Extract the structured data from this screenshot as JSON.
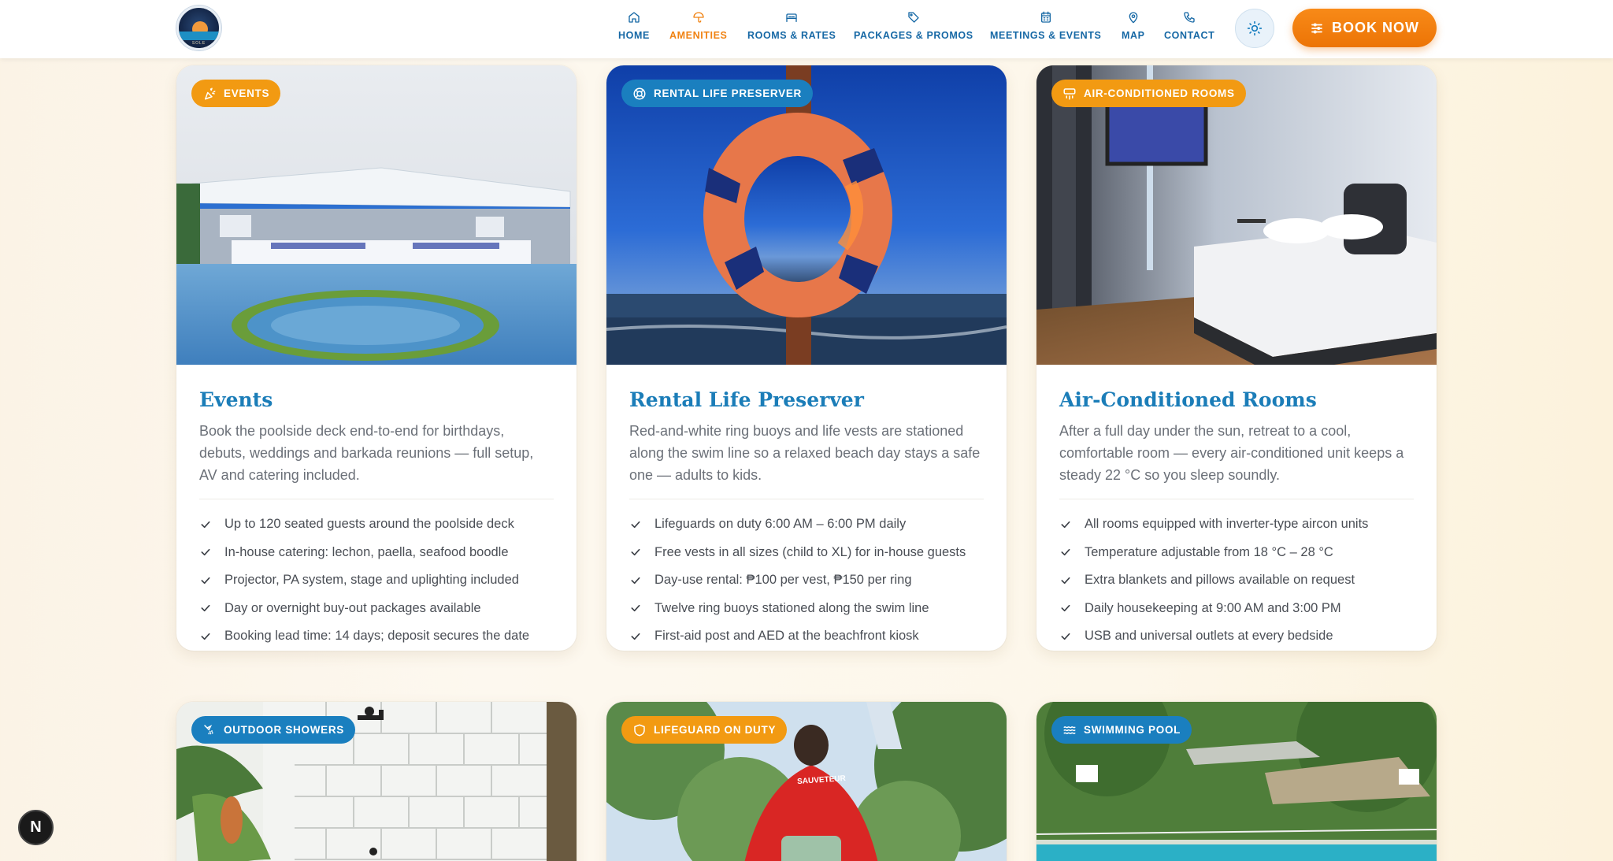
{
  "brand": {
    "logo_text": "SOLE"
  },
  "nav": {
    "items": [
      {
        "label": "HOME",
        "icon": "home-icon"
      },
      {
        "label": "AMENITIES",
        "icon": "umbrella-icon",
        "active": true
      },
      {
        "label": "ROOMS & RATES",
        "icon": "bed-icon"
      },
      {
        "label": "PACKAGES & PROMOS",
        "icon": "tag-icon"
      },
      {
        "label": "MEETINGS & EVENTS",
        "icon": "calendar-icon"
      },
      {
        "label": "MAP",
        "icon": "map-pin-icon"
      },
      {
        "label": "CONTACT",
        "icon": "phone-icon"
      }
    ],
    "theme_toggle_icon": "sun-icon",
    "book_now_label": "BOOK NOW"
  },
  "colors": {
    "brand_blue": "#1668a5",
    "accent_orange": "#f08212",
    "badge_orange": "#f29a12",
    "badge_blue": "#1a7fbf"
  },
  "cards": [
    {
      "badge": "EVENTS",
      "badge_icon": "party-popper-icon",
      "badge_color": "orange",
      "title": "Events",
      "description": "Book the poolside deck end-to-end for birthdays, debuts, weddings and barkada reunions — full setup, AV and catering included.",
      "features": [
        "Up to 120 seated guests around the poolside deck",
        "In-house catering: lechon, paella, seafood boodle",
        "Projector, PA system, stage and uplighting included",
        "Day or overnight buy-out packages available",
        "Booking lead time: 14 days; deposit secures the date"
      ]
    },
    {
      "badge": "RENTAL LIFE PRESERVER",
      "badge_icon": "life-buoy-icon",
      "badge_color": "blue",
      "title": "Rental Life Preserver",
      "description": "Red-and-white ring buoys and life vests are stationed along the swim line so a relaxed beach day stays a safe one — adults to kids.",
      "features": [
        "Lifeguards on duty 6:00 AM – 6:00 PM daily",
        "Free vests in all sizes (child to XL) for in-house guests",
        "Day-use rental: ₱100 per vest, ₱150 per ring",
        "Twelve ring buoys stationed along the swim line",
        "First-aid post and AED at the beachfront kiosk"
      ]
    },
    {
      "badge": "AIR-CONDITIONED ROOMS",
      "badge_icon": "air-vent-icon",
      "badge_color": "orange",
      "title": "Air-Conditioned Rooms",
      "description": "After a full day under the sun, retreat to a cool, comfortable room — every air-conditioned unit keeps a steady 22 °C so you sleep soundly.",
      "features": [
        "All rooms equipped with inverter-type aircon units",
        "Temperature adjustable from 18 °C – 28 °C",
        "Extra blankets and pillows available on request",
        "Daily housekeeping at 9:00 AM and 3:00 PM",
        "USB and universal outlets at every bedside"
      ]
    },
    {
      "badge": "OUTDOOR SHOWERS",
      "badge_icon": "shower-head-icon",
      "badge_color": "blue"
    },
    {
      "badge": "LIFEGUARD ON DUTY",
      "badge_icon": "shield-icon",
      "badge_color": "orange",
      "shirt_text": "SAUVETEUR"
    },
    {
      "badge": "SWIMMING POOL",
      "badge_icon": "waves-icon",
      "badge_color": "blue"
    }
  ],
  "corner_button": {
    "label": "N"
  }
}
